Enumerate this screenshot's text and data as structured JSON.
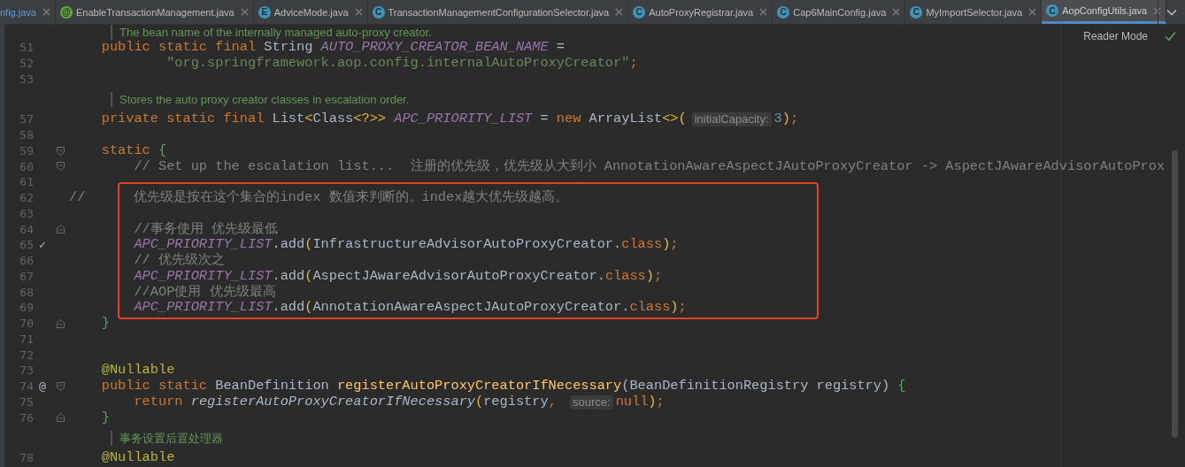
{
  "tabs": [
    {
      "label": "nfig.java",
      "selected": false
    },
    {
      "label": "EnableTransactionManagement.java",
      "icon": {
        "kind": "annotation",
        "letter": "@"
      },
      "selected": false
    },
    {
      "label": "AdviceMode.java",
      "icon": {
        "kind": "enum",
        "letter": "E"
      },
      "selected": false
    },
    {
      "label": "TransactionManagementConfigurationSelector.java",
      "icon": {
        "kind": "class",
        "letter": "C"
      },
      "selected": false
    },
    {
      "label": "AutoProxyRegistrar.java",
      "icon": {
        "kind": "class",
        "letter": "C"
      },
      "selected": false
    },
    {
      "label": "Cap6MainConfig.java",
      "icon": {
        "kind": "class",
        "letter": "C"
      },
      "selected": false
    },
    {
      "label": "MyImportSelector.java",
      "icon": {
        "kind": "class",
        "letter": "C"
      },
      "selected": false
    },
    {
      "label": "AopConfigUtils.java",
      "icon": {
        "kind": "class",
        "letter": "C"
      },
      "selected": true
    }
  ],
  "reader_mode": "Reader Mode",
  "code": {
    "lines": [
      {
        "kind": "doc",
        "text": "The bean name of the internally managed auto-proxy creator."
      },
      {
        "kind": "code",
        "number": "51",
        "tokens": [
          {
            "kind": "kw",
            "text": "    public static final "
          },
          {
            "kind": "plain",
            "text": "String "
          },
          {
            "kind": "field",
            "text": "AUTO_PROXY_CREATOR_BEAN_NAME"
          },
          {
            "kind": "plain",
            "text": " ="
          }
        ]
      },
      {
        "kind": "code",
        "number": "52",
        "tokens": [
          {
            "kind": "str",
            "text": "            \"org.springframework.aop.config.internalAutoProxyCreator\""
          },
          {
            "kind": "kw",
            "text": ";"
          }
        ]
      },
      {
        "kind": "code",
        "number": "53"
      },
      {
        "kind": "doc",
        "text": "Stores the auto proxy creator classes in escalation order."
      },
      {
        "kind": "code",
        "number": "57",
        "tokens": [
          {
            "kind": "kw",
            "text": "    private static final "
          },
          {
            "kind": "plain",
            "text": "List"
          },
          {
            "kind": "bracket",
            "text": "<"
          },
          {
            "kind": "plain",
            "text": "Class"
          },
          {
            "kind": "bracket",
            "text": "<?>>"
          },
          {
            "kind": "field",
            "text": " APC_PRIORITY_LIST"
          },
          {
            "kind": "plain",
            "text": " = "
          },
          {
            "kind": "kw",
            "text": "new "
          },
          {
            "kind": "plain",
            "text": "ArrayList"
          },
          {
            "kind": "bracket",
            "text": "<>("
          },
          {
            "kind": "hint",
            "text": "initialCapacity:"
          },
          {
            "kind": "number",
            "text": "3"
          },
          {
            "kind": "bracket",
            "text": ")"
          },
          {
            "kind": "kw",
            "text": ";"
          }
        ]
      },
      {
        "kind": "code",
        "number": "58"
      },
      {
        "kind": "code",
        "number": "59",
        "fold": {
          "kind": "start"
        },
        "tokens": [
          {
            "kind": "kw",
            "text": "    static "
          },
          {
            "kind": "brace",
            "text": "{"
          }
        ]
      },
      {
        "kind": "code",
        "number": "60",
        "fold": {
          "kind": "start"
        },
        "tokens": [
          {
            "kind": "comment",
            "text": "        // Set up the escalation list...  注册的优先级，优先级从大到小 AnnotationAwareAspectJAutoProxyCreator -> AspectJAwareAdvisorAutoProx"
          }
        ]
      },
      {
        "kind": "code",
        "number": "61"
      },
      {
        "kind": "frame",
        "lines": [
          {
            "kind": "code",
            "number": "62",
            "tokens": [
              {
                "kind": "comment",
                "text": "//      优先级是按在这个集合的index 数值来判断的。index越大优先级越高。"
              }
            ]
          },
          {
            "kind": "code",
            "number": "63"
          },
          {
            "kind": "code",
            "number": "64",
            "fold": {
              "kind": "end"
            },
            "tokens": [
              {
                "kind": "comment",
                "text": "        //事务使用 优先级最低"
              }
            ]
          },
          {
            "kind": "code",
            "number": "65",
            "marker": "✓",
            "tokens": [
              {
                "kind": "field",
                "text": "        APC_PRIORITY_LIST"
              },
              {
                "kind": "plain",
                "text": ".add"
              },
              {
                "kind": "bracket",
                "text": "("
              },
              {
                "kind": "plain",
                "text": "InfrastructureAdvisorAutoProxyCreator."
              },
              {
                "kind": "kw",
                "text": "class"
              },
              {
                "kind": "bracket",
                "text": ")"
              },
              {
                "kind": "kw",
                "text": ";"
              }
            ]
          },
          {
            "kind": "code",
            "number": "66",
            "tokens": [
              {
                "kind": "comment",
                "text": "        // 优先级次之"
              }
            ]
          },
          {
            "kind": "code",
            "number": "67",
            "tokens": [
              {
                "kind": "field",
                "text": "        APC_PRIORITY_LIST"
              },
              {
                "kind": "plain",
                "text": ".add"
              },
              {
                "kind": "bracket",
                "text": "("
              },
              {
                "kind": "plain",
                "text": "AspectJAwareAdvisorAutoProxyCreator."
              },
              {
                "kind": "kw",
                "text": "class"
              },
              {
                "kind": "bracket",
                "text": ")"
              },
              {
                "kind": "kw",
                "text": ";"
              }
            ]
          },
          {
            "kind": "code",
            "number": "68",
            "tokens": [
              {
                "kind": "comment",
                "text": "        //AOP使用 优先级最高"
              }
            ]
          },
          {
            "kind": "code",
            "number": "69",
            "tokens": [
              {
                "kind": "field",
                "text": "        APC_PRIORITY_LIST"
              },
              {
                "kind": "plain",
                "text": ".add"
              },
              {
                "kind": "bracket",
                "text": "("
              },
              {
                "kind": "plain",
                "text": "AnnotationAwareAspectJAutoProxyCreator."
              },
              {
                "kind": "kw",
                "text": "class"
              },
              {
                "kind": "bracket",
                "text": ")"
              },
              {
                "kind": "kw",
                "text": ";"
              }
            ]
          }
        ]
      },
      {
        "kind": "code",
        "number": "70",
        "fold": {
          "kind": "end"
        },
        "tokens": [
          {
            "kind": "brace",
            "text": "    }"
          }
        ]
      },
      {
        "kind": "code",
        "number": "71"
      },
      {
        "kind": "code",
        "number": "72"
      },
      {
        "kind": "code",
        "number": "73",
        "tokens": [
          {
            "kind": "annot",
            "text": "    @Nullable"
          }
        ]
      },
      {
        "kind": "code",
        "number": "74",
        "marker": "@",
        "fold": {
          "kind": "start"
        },
        "tokens": [
          {
            "kind": "kw",
            "text": "    public static "
          },
          {
            "kind": "plain",
            "text": "BeanDefinition "
          },
          {
            "kind": "method",
            "text": "registerAutoProxyCreatorIfNecessary"
          },
          {
            "kind": "plain",
            "text": "(BeanDefinitionRegistry registry) "
          },
          {
            "kind": "brace",
            "text": "{"
          }
        ]
      },
      {
        "kind": "code",
        "number": "75",
        "tokens": [
          {
            "kind": "kw",
            "text": "        return "
          },
          {
            "kind": "call",
            "text": "registerAutoProxyCreatorIfNecessary"
          },
          {
            "kind": "bracket",
            "text": "("
          },
          {
            "kind": "plain",
            "text": "registry"
          },
          {
            "kind": "kw",
            "text": ", "
          },
          {
            "kind": "hint",
            "text": "source:"
          },
          {
            "kind": "kw",
            "text": "null"
          },
          {
            "kind": "bracket",
            "text": ")"
          },
          {
            "kind": "kw",
            "text": ";"
          }
        ]
      },
      {
        "kind": "code",
        "number": "76",
        "fold": {
          "kind": "end"
        },
        "tokens": [
          {
            "kind": "brace",
            "text": "    }"
          }
        ]
      },
      {
        "kind": "doc",
        "text": "事务设置后置处理器"
      },
      {
        "kind": "code",
        "number": "78",
        "tokens": [
          {
            "kind": "annot",
            "text": "    @Nullable"
          }
        ]
      }
    ]
  }
}
